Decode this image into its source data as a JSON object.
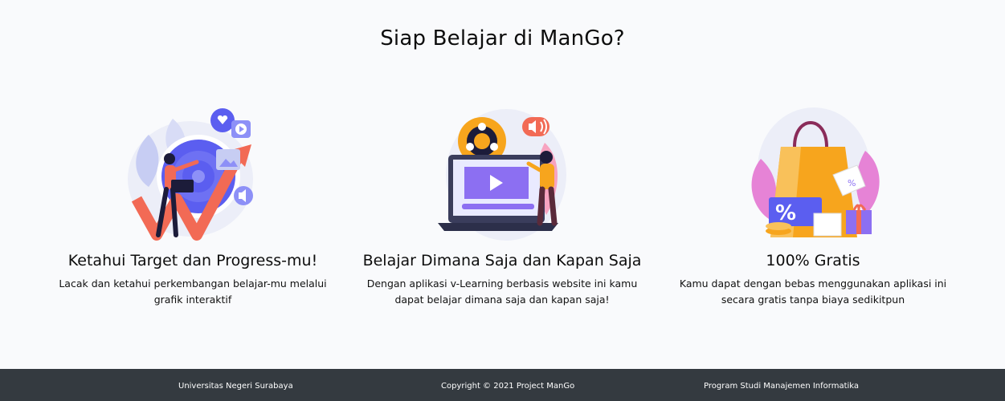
{
  "section": {
    "title": "Siap Belajar di ManGo?"
  },
  "features": [
    {
      "title": "Ketahui Target dan Progress-mu!",
      "description": "Lacak dan ketahui perkembangan belajar-mu melalui grafik interaktif",
      "illustration": "target-progress-illustration"
    },
    {
      "title": "Belajar Dimana Saja dan Kapan Saja",
      "description": "Dengan aplikasi v-Learning berbasis website ini kamu dapat belajar dimana saja dan kapan saja!",
      "illustration": "learn-anywhere-illustration"
    },
    {
      "title": "100% Gratis",
      "description": "Kamu dapat dengan bebas menggunakan aplikasi ini secara gratis tanpa biaya sedikitpun",
      "illustration": "free-shopping-bag-illustration"
    }
  ],
  "footer": {
    "left": "Universitas Negeri Surabaya",
    "center": "Copyright © 2021 Project ManGo",
    "right": "Program Studi Manajemen Informatika"
  },
  "colors": {
    "background": "#f9fafc",
    "footer": "#343a40",
    "accent_blue": "#5b5ef0",
    "accent_orange": "#f7a51d",
    "accent_coral": "#f26a55",
    "accent_purple": "#8c6ff2"
  }
}
